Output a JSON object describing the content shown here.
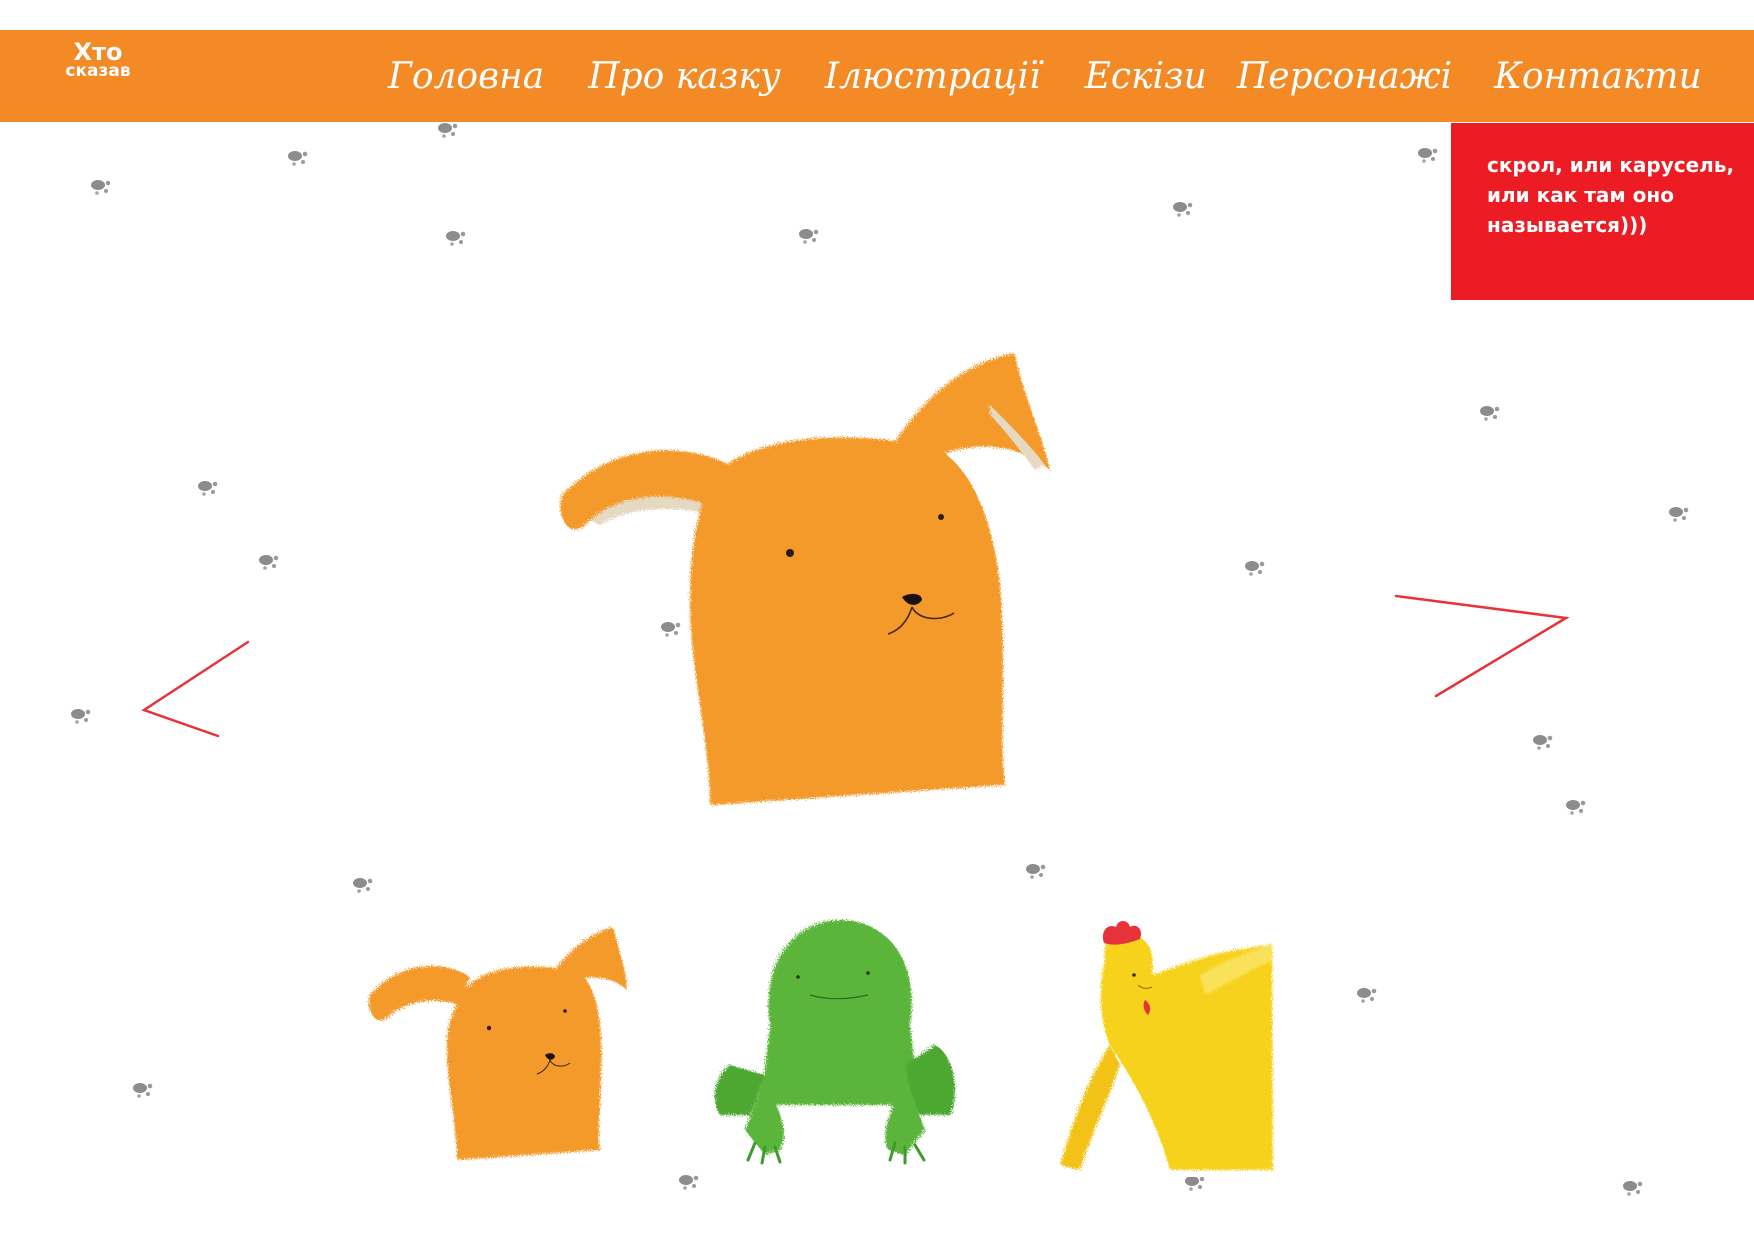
{
  "logo": {
    "line1": "Хто",
    "line2": "сказав"
  },
  "nav": {
    "items": [
      "Головна",
      "Про казку",
      "Ілюстрації",
      "Ескізи",
      "Персонажі",
      "Контакти"
    ]
  },
  "note": {
    "lines": [
      "скрол, или карусель,",
      "или как там оно",
      "называется)))"
    ]
  },
  "colors": {
    "brand_orange": "#f38a25",
    "note_red": "#ed1c24",
    "arrow_red": "#e8323a",
    "creature_orange": "#f39a2c",
    "frog_green": "#5cb53a",
    "chicken_yellow": "#f7d21e"
  },
  "carousel": {
    "prev_icon": "chevron-left-icon",
    "next_icon": "chevron-right-icon",
    "main_image": "orange-dog-illustration",
    "thumbnails": [
      "orange-dog-thumbnail",
      "green-frog-thumbnail",
      "yellow-chicken-thumbnail"
    ]
  }
}
